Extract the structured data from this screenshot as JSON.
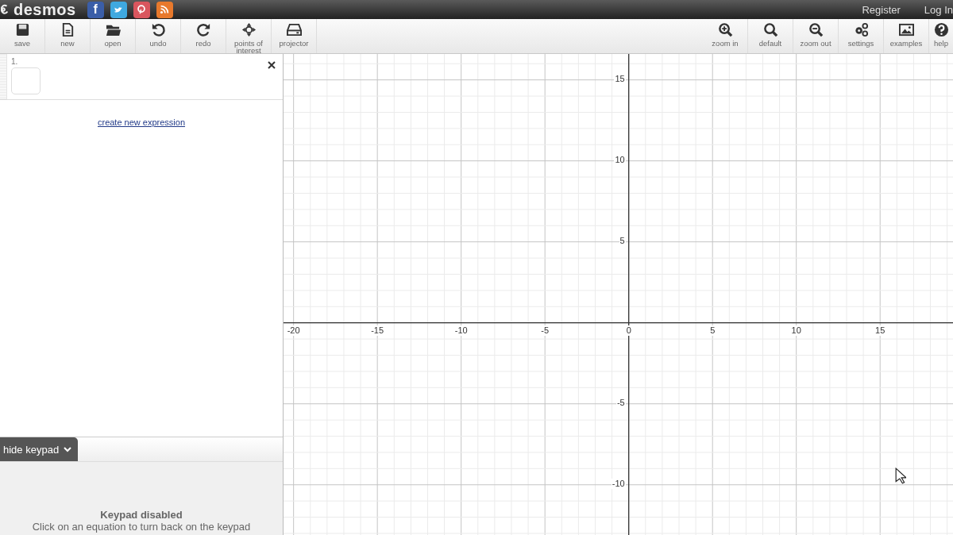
{
  "header": {
    "logo": "desmos",
    "social": [
      {
        "kind": "facebook",
        "glyph": "f",
        "color": "#3b5ea8"
      },
      {
        "kind": "twitter",
        "color": "#3fa9e0"
      },
      {
        "kind": "pinterest",
        "color": "#d9565e"
      },
      {
        "kind": "rss",
        "color": "#e8792c"
      }
    ],
    "links": [
      "Register",
      "Log In"
    ]
  },
  "toolbar": {
    "left": [
      {
        "kind": "save",
        "label": "save"
      },
      {
        "kind": "new",
        "label": "new"
      },
      {
        "kind": "open",
        "label": "open"
      },
      {
        "kind": "undo",
        "label": "undo"
      },
      {
        "kind": "redo",
        "label": "redo"
      },
      {
        "kind": "poi",
        "label": "points of interest"
      },
      {
        "kind": "projector",
        "label": "projector"
      }
    ],
    "right": [
      {
        "kind": "zoomin",
        "label": "zoom in"
      },
      {
        "kind": "default",
        "label": "default"
      },
      {
        "kind": "zoomout",
        "label": "zoom out"
      },
      {
        "kind": "settings",
        "label": "settings"
      },
      {
        "kind": "examples",
        "label": "examples"
      },
      {
        "kind": "help",
        "label": "help"
      }
    ]
  },
  "expressions": [
    {
      "number": "1."
    }
  ],
  "new_expression_link": "create new expression",
  "keypad": {
    "toggle": "hide keypad",
    "title": "Keypad disabled",
    "message": "Click on an equation to turn back on the keypad"
  },
  "graph": {
    "chart_data": {
      "type": "line",
      "grid": true,
      "xlim": [
        -20.6,
        19.35
      ],
      "ylim": [
        -13.1,
        16.6
      ],
      "xticks": [
        -20,
        -15,
        -10,
        -5,
        0,
        5,
        10,
        15
      ],
      "yticks": [
        -10,
        -5,
        5,
        10,
        15
      ]
    }
  }
}
